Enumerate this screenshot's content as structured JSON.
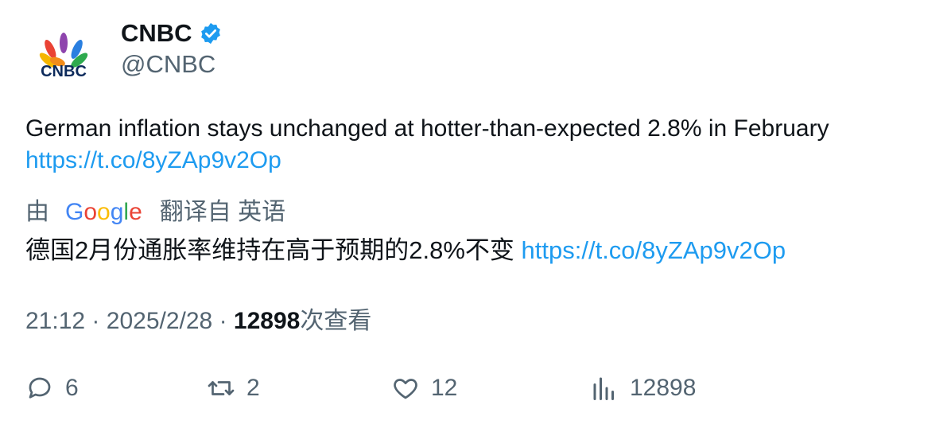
{
  "author": {
    "display_name": "CNBC",
    "handle": "@CNBC",
    "avatar_icon": "cnbc-peacock-logo",
    "verified_icon": "verified-badge-icon",
    "verified_color": "#1d9bf0"
  },
  "tweet": {
    "text": "German inflation stays unchanged at hotter-than-expected 2.8% in February",
    "link": "https://t.co/8yZAp9v2Op"
  },
  "translation": {
    "prefix": "由",
    "provider": "Google",
    "suffix": "翻译自 英语",
    "text": "德国2月份通胀率维持在高于预期的2.8%不变",
    "link": "https://t.co/8yZAp9v2Op"
  },
  "meta": {
    "time": "21:12",
    "separator": "·",
    "date": "2025/2/28",
    "views_count": "12898",
    "views_label": "次查看"
  },
  "actions": {
    "reply": {
      "icon": "reply-icon",
      "count": "6"
    },
    "retweet": {
      "icon": "retweet-icon",
      "count": "2"
    },
    "like": {
      "icon": "heart-icon",
      "count": "12"
    },
    "views": {
      "icon": "analytics-icon",
      "count": "12898"
    }
  },
  "colors": {
    "link": "#1d9bf0",
    "secondary_text": "#536471",
    "primary_text": "#0f1419"
  }
}
